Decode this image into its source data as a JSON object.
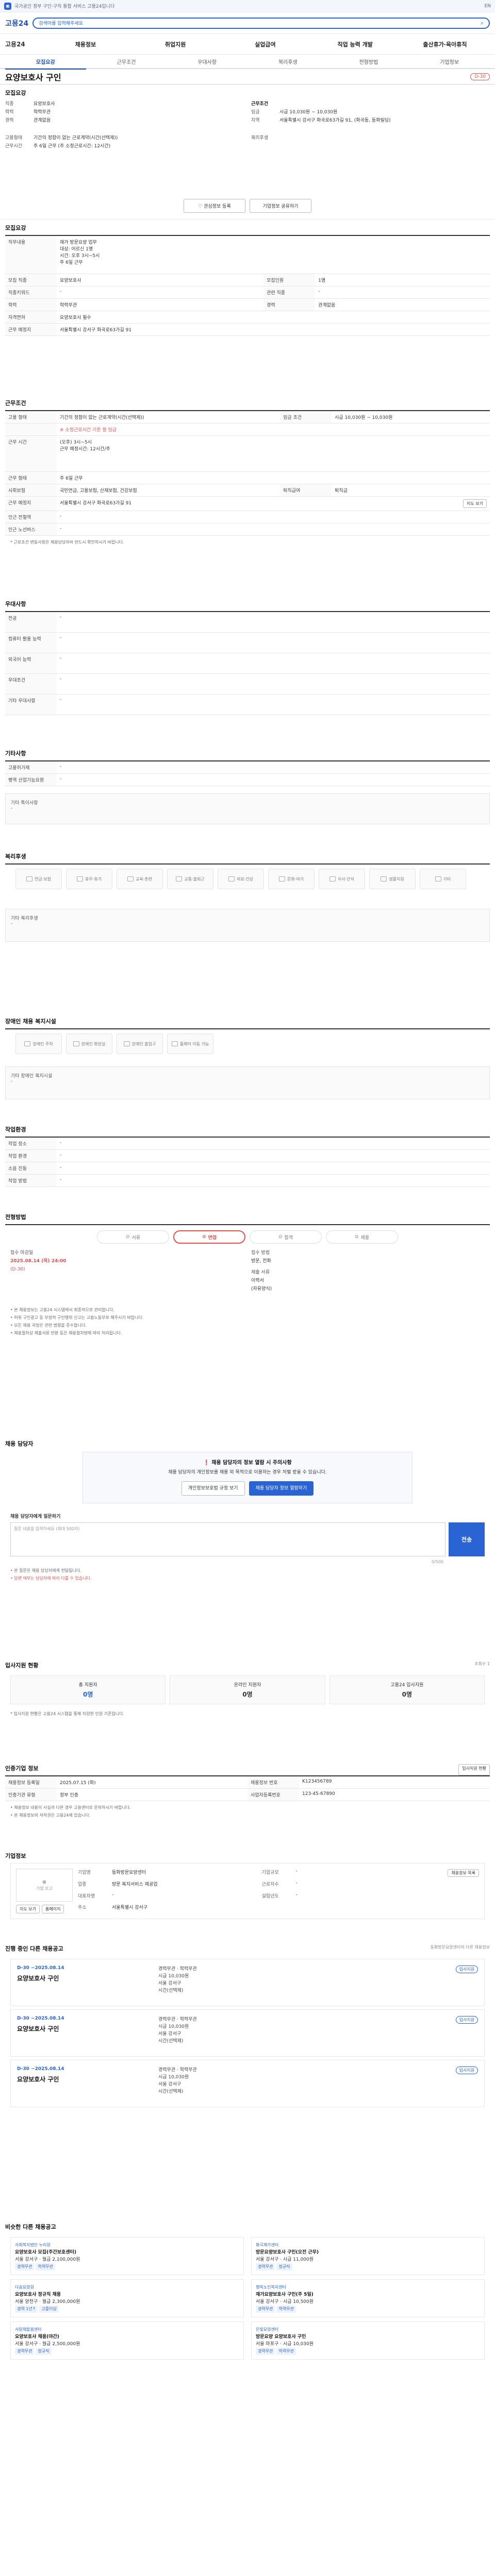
{
  "top": {
    "notice": "국가공인 정부 구인·구직 통합 서비스 고용24입니다",
    "lang": "EN"
  },
  "header": {
    "brand": "고용24",
    "search_placeholder": "검색어를 입력해주세요"
  },
  "gnb": {
    "home": "고용24",
    "items": [
      "채용정보",
      "취업지원",
      "실업급여",
      "직업 능력 개발",
      "출산휴가·육아휴직"
    ]
  },
  "subtabs": [
    "모집요강",
    "근무조건",
    "우대사항",
    "복리후생",
    "전형방법",
    "기업정보"
  ],
  "job": {
    "title": "요양보호사 구인",
    "tag": "D-30"
  },
  "recruit": {
    "h": "모집요강",
    "job_k": "직종",
    "job": "요양보호사",
    "edu_k": "학력",
    "edu": "학력무관",
    "career_k": "경력",
    "career": "관계없음",
    "work_k": "근무조건",
    "wage_k": "임금",
    "wage": "시급 10,030원 ~ 10,030원",
    "loc_k": "지역",
    "loc": "서울특별시 강서구 화곡로63가길 91, (화곡동, 동화빌딩)",
    "emp_k": "고용형태",
    "emp": "기간의 정함이 없는 근로계약(시간(선택제))",
    "hours_k": "근무시간",
    "hours": "주 6일 근무 (주 소정근로시간: 12시간)",
    "welfare_k": "복리후생"
  },
  "actions": {
    "interest": "관심정보 등록",
    "share": "기업정보 공유하기",
    "apply": "입사지원"
  },
  "detail": {
    "h": "모집요강",
    "duty_k": "직무내용",
    "duty": "재가 방문요양 업무\n대상: 어르신 1명\n시간: 오후 3시~5시\n주 6일 근무",
    "job_k": "모집 직종",
    "job": "요양보호사",
    "jobk_k": "직종키워드",
    "jobk": "-",
    "rel_k": "관련 직종",
    "rel": "-",
    "count_k": "모집인원",
    "count": "1명",
    "edu_k": "학력",
    "edu": "학력무관",
    "career_k": "경력",
    "career": "관계없음",
    "lic_k": "자격면허",
    "lic": "요양보호사 필수",
    "place_k": "근무 예정지",
    "place": "서울특별시 강서구 화곡로63가길 91"
  },
  "cond": {
    "h": "근무조건",
    "emp_k": "고용 형태",
    "emp": "기간의 정함이 없는 근로계약(시간(선택제))",
    "wage_k": "임금 조건",
    "wage": "시급 10,030원 ~ 10,030원",
    "wage_note": "※ 소정근로시간 기준 월 임금",
    "hours_k": "근무 시간",
    "hours": "(오후) 3시~5시\n근무 예정시간: 12시간/주",
    "days_k": "근무 형태",
    "days": "주 6일 근무",
    "ins_k": "사회보험",
    "ins": "국민연금, 고용보험, 산재보험, 건강보험",
    "retire_k": "퇴직급여",
    "retire": "퇴직금",
    "loc_k": "근무 예정지",
    "loc": "서울특별시 강서구 화곡로63가길 91",
    "map_btn": "지도 보기",
    "sub_k": "인근 전철역",
    "sub": "-",
    "bus_k": "인근 노선버스",
    "bus": "-",
    "note": "* 근로조건 변동사항은 채용담당자와 반드시 확인하시기 바랍니다."
  },
  "pref": {
    "h": "우대사항",
    "rows": [
      {
        "k": "전공",
        "v": "-"
      },
      {
        "k": "컴퓨터 활용 능력",
        "v": "-"
      },
      {
        "k": "외국어 능력",
        "v": "-"
      },
      {
        "k": "우대조건",
        "v": "-"
      },
      {
        "k": "기타 우대사항",
        "v": "-"
      }
    ]
  },
  "etc": {
    "h": "기타사항",
    "rows": [
      {
        "k": "고용허가제",
        "v": "-"
      },
      {
        "k": "병역 산업기능요원",
        "v": "-"
      }
    ],
    "box": "기타 특이사항",
    "box_v": "-"
  },
  "welfare": {
    "h": "복리후생",
    "items": [
      "연금·보험",
      "휴무·휴가",
      "교육·훈련",
      "교통·출퇴근",
      "의료·건강",
      "문화·여가",
      "식사·간식",
      "생활지원",
      "기타"
    ],
    "box": "기타 복리후생",
    "box_v": "-"
  },
  "disabled": {
    "h": "장애인 채용 복지시설",
    "items": [
      "장애인 주차",
      "장애인 화장실",
      "장애인 출입구",
      "휠체어 이동 가능"
    ],
    "box": "기타 장애인 복지시설",
    "box_v": "-"
  },
  "work": {
    "h": "작업환경",
    "rows": [
      {
        "k": "작업 장소",
        "v": "-",
        "k2": "",
        "v2": ""
      },
      {
        "k": "작업 환경",
        "v": "-",
        "k2": "",
        "v2": ""
      },
      {
        "k": "소음 진동",
        "v": "-",
        "k2": "",
        "v2": ""
      },
      {
        "k": "작업 방법",
        "v": "-",
        "k2": "",
        "v2": ""
      }
    ]
  },
  "screen": {
    "h": "전형방법",
    "steps": [
      "서류",
      "면접",
      "합격",
      "채용"
    ],
    "deadline_k": "접수 마감일",
    "deadline": "2025.08.14 (목) 24:00",
    "deadline_sub": "(D-30)",
    "method_k": "접수 방법",
    "method": "방문, 전화",
    "doc_k": "제출 서류",
    "doc": "이력서",
    "doc_sub": "(자유양식)",
    "notes": [
      "• 본 채용정보는 고용24 시스템에서 최종적으로 관리합니다.",
      "• 허위 구인광고 등 부정적 구인행위 신고는 고용노동부로 해주시기 바랍니다.",
      "• 모든 채용 과정은 관련 법령을 준수합니다.",
      "• 채용절차상 제출서류 반환 등은 채용절차법에 따라 처리됩니다."
    ]
  },
  "contact": {
    "h": "채용 담당자",
    "c_title": "채용 담당자의 정보 열람 시 주의사항",
    "c_body": "채용 담당자의 개인정보를 채용 외 목적으로 이용하는 경우 처벌 받을 수 있습니다.",
    "c_btn1": "개인정보보호법 규정 보기",
    "c_btn2": "채용 담당자 정보 열람하기",
    "q_h": "채용 담당자에게 질문하기",
    "q_placeholder": "질문 내용을 입력하세요 (최대 500자)",
    "q_btn": "전송",
    "q_count": "0/500",
    "q_notes": [
      "• 본 질문은 채용 담당자에게 전달됩니다.",
      "• 답변 여부는 담당자에 따라 다를 수 있습니다."
    ]
  },
  "stats": {
    "h": "입사지원 현황",
    "view": "조회수 1",
    "items": [
      {
        "k": "총 지원자",
        "v": "0명"
      },
      {
        "k": "온라인 지원자",
        "v": "0명"
      },
      {
        "k": "고용24 입사지원",
        "v": "0명"
      }
    ],
    "note": "* 입사지원 현황은 고용24 시스템을 통해 지원한 인원 기준입니다."
  },
  "reginfo": {
    "h": "인증기업 정보",
    "k1": "채용정보 등록일",
    "v1": "2025.07.15 (화)",
    "k2": "채용정보 번호",
    "v2": "K123456789",
    "k3": "인증기관 유형",
    "v3": "정부 인증",
    "k4": "사업자등록번호",
    "v4": "123-45-67890",
    "btn": "입사지원 현황",
    "notes": [
      "• 채용정보 내용이 사실과 다른 경우 고용센터로 문의하시기 바랍니다.",
      "• 본 채용정보의 저작권은 고용24에 있습니다."
    ]
  },
  "company": {
    "h": "기업정보",
    "logo": "기업 로고",
    "map_btn": "지도 보기",
    "homepage_btn": "홈페이지",
    "name_k": "기업명",
    "name": "동화방문요양센터",
    "ind_k": "업종",
    "ind": "방문 복지서비스 제공업",
    "size_k": "기업규모",
    "size": "-",
    "emp_k": "근로자수",
    "emp": "-",
    "ceo_k": "대표자명",
    "ceo": "-",
    "year_k": "설립년도",
    "year": "-",
    "addr_k": "주소",
    "addr": "서울특별시 강서구",
    "list_btn": "채용정보 목록"
  },
  "others": {
    "h": "진행 중인 다른 채용공고",
    "sub": "동화방문요양센터의 다른 채용정보",
    "cards": [
      {
        "date": "D-30 ~2025.08.14",
        "title": "요양보호사 구인",
        "career": "경력무관",
        "edu": "학력무관",
        "wage": "시급 10,030원",
        "loc": "서울 강서구",
        "emp": "시간(선택제)",
        "status": "입사지원"
      },
      {
        "date": "D-30 ~2025.08.14",
        "title": "요양보호사 구인",
        "career": "경력무관",
        "edu": "학력무관",
        "wage": "시급 10,030원",
        "loc": "서울 강서구",
        "emp": "시간(선택제)",
        "status": "입사지원"
      },
      {
        "date": "D-30 ~2025.08.14",
        "title": "요양보호사 구인",
        "career": "경력무관",
        "edu": "학력무관",
        "wage": "시급 10,030원",
        "loc": "서울 강서구",
        "emp": "시간(선택제)",
        "status": "입사지원"
      }
    ]
  },
  "similar": {
    "h": "비슷한 다른 채용공고",
    "items": [
      {
        "co": "사회복지법인 누리원",
        "title": "요양보호사 모집(주간보호센터)",
        "meta": "서울 강서구 · 월급 2,100,000원",
        "tags": [
          "경력무관",
          "학력무관"
        ]
      },
      {
        "co": "화곡재가센터",
        "title": "방문요양보호사 구인(오전 근무)",
        "meta": "서울 강서구 · 시급 11,000원",
        "tags": [
          "경력무관",
          "정규직"
        ]
      },
      {
        "co": "다솜요양원",
        "title": "요양보호사 정규직 채용",
        "meta": "서울 양천구 · 월급 2,300,000원",
        "tags": [
          "경력 1년↑",
          "고졸이상"
        ]
      },
      {
        "co": "행복노인복지센터",
        "title": "재가요양보호사 구인(주 5일)",
        "meta": "서울 강서구 · 시급 10,500원",
        "tags": [
          "경력무관",
          "학력무관"
        ]
      },
      {
        "co": "사랑채돌봄센터",
        "title": "요양보호사 채용(야간)",
        "meta": "서울 강서구 · 월급 2,500,000원",
        "tags": [
          "경력무관",
          "정규직"
        ]
      },
      {
        "co": "은빛요양센터",
        "title": "방문요양 요양보호사 구인",
        "meta": "서울 마포구 · 시급 10,030원",
        "tags": [
          "경력무관",
          "학력무관"
        ]
      }
    ]
  }
}
